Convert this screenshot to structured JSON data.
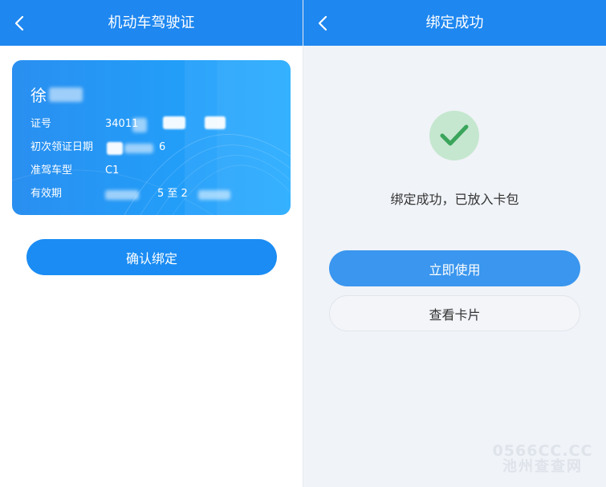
{
  "left_screen": {
    "title": "机动车驾驶证",
    "card": {
      "name": "徐",
      "fields": [
        {
          "label": "证号",
          "value": "34011"
        },
        {
          "label": "初次领证日期",
          "value": "6"
        },
        {
          "label": "准驾车型",
          "value": "C1"
        },
        {
          "label": "有效期",
          "value": "5 至 2"
        }
      ]
    },
    "confirm_button": "确认绑定"
  },
  "right_screen": {
    "title": "绑定成功",
    "success_message": "绑定成功，已放入卡包",
    "use_button": "立即使用",
    "view_card_button": "查看卡片"
  },
  "watermark": {
    "line1": "0566CC.CC",
    "line2": "池州查查网"
  },
  "colors": {
    "nav_blue": "#1e87f0",
    "card_blue": "#1da8ff",
    "button_blue": "#1a8cf3",
    "success_green": "#3aa55b",
    "success_bg": "#c5e7cf"
  },
  "icons": [
    "chevron-left-icon",
    "check-icon"
  ]
}
